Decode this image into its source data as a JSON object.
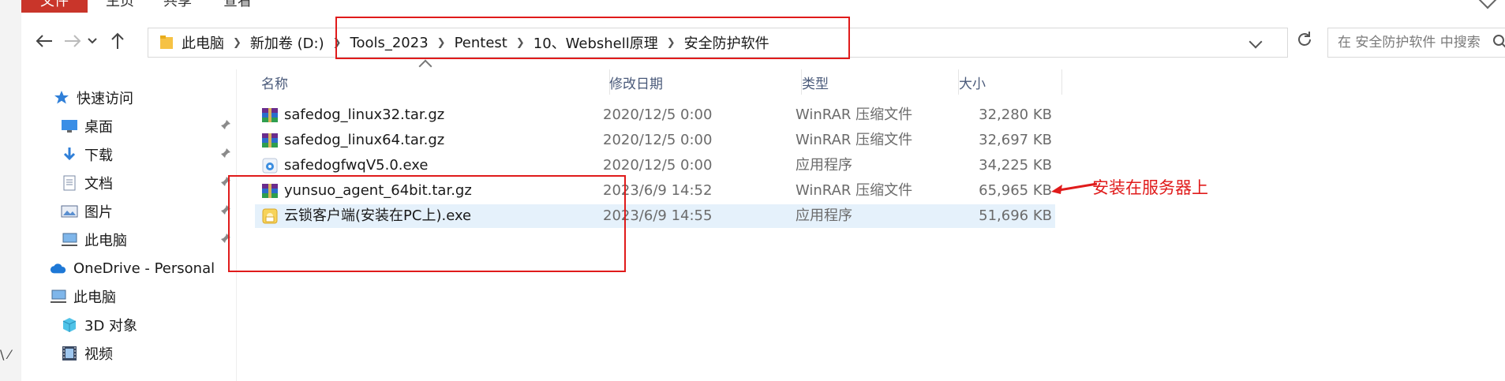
{
  "ribbon": {
    "tabs": [
      "文件",
      "主页",
      "共享",
      "查看"
    ]
  },
  "nav": {
    "breadcrumbs": [
      "此电脑",
      "新加卷 (D:)",
      "Tools_2023",
      "Pentest",
      "10、Webshell原理",
      "安全防护软件"
    ]
  },
  "search": {
    "placeholder": "在 安全防护软件 中搜索"
  },
  "sidebar": {
    "items": [
      {
        "label": "快速访问",
        "icon": "star-icon"
      },
      {
        "label": "桌面",
        "icon": "desktop-icon",
        "pinned": true
      },
      {
        "label": "下载",
        "icon": "download-icon",
        "pinned": true
      },
      {
        "label": "文档",
        "icon": "document-icon",
        "pinned": true
      },
      {
        "label": "图片",
        "icon": "picture-icon",
        "pinned": true
      },
      {
        "label": "此电脑",
        "icon": "computer-icon",
        "pinned": true
      },
      {
        "label": "OneDrive - Personal",
        "icon": "cloud-icon"
      },
      {
        "label": "此电脑",
        "icon": "computer-icon"
      },
      {
        "label": "3D 对象",
        "icon": "cube-icon"
      },
      {
        "label": "视频",
        "icon": "video-icon"
      }
    ]
  },
  "columns": {
    "name": "名称",
    "date": "修改日期",
    "type": "类型",
    "size": "大小"
  },
  "files": [
    {
      "name": "safedog_linux32.tar.gz",
      "date": "2020/12/5 0:00",
      "type": "WinRAR 压缩文件",
      "size": "32,280 KB",
      "icon": "archive-icon"
    },
    {
      "name": "safedog_linux64.tar.gz",
      "date": "2020/12/5 0:00",
      "type": "WinRAR 压缩文件",
      "size": "32,697 KB",
      "icon": "archive-icon"
    },
    {
      "name": "safedogfwqV5.0.exe",
      "date": "2020/12/5 0:00",
      "type": "应用程序",
      "size": "34,225 KB",
      "icon": "exe-icon"
    },
    {
      "name": "yunsuo_agent_64bit.tar.gz",
      "date": "2023/6/9 14:52",
      "type": "WinRAR 压缩文件",
      "size": "65,965 KB",
      "icon": "archive-icon"
    },
    {
      "name": "云锁客户端(安装在PC上).exe",
      "date": "2023/6/9 14:55",
      "type": "应用程序",
      "size": "51,696 KB",
      "icon": "exe-icon",
      "selected": true
    }
  ],
  "annotation": {
    "text": "安装在服务器上"
  },
  "colors": {
    "accent_red": "#e01b1b",
    "selection": "#e5f1fb",
    "ribbon_file": "#c9352a"
  }
}
